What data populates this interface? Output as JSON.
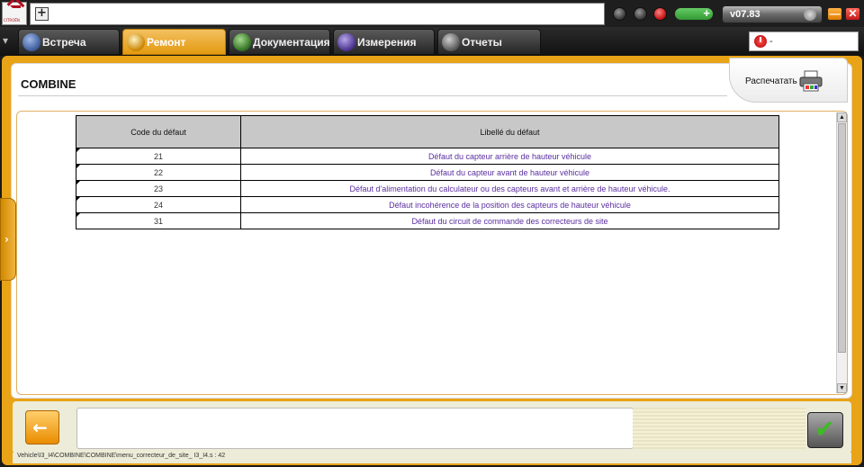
{
  "app": {
    "logo_text": "CITROËN",
    "version": "v07.83"
  },
  "tabs": [
    {
      "label": "Встреча",
      "icon": "reception-icon",
      "color": "#5a7fbf"
    },
    {
      "label": "Ремонт",
      "icon": "magnifier-icon",
      "color": "#e39a10"
    },
    {
      "label": "Документация",
      "icon": "document-icon",
      "color": "#4d8f3a"
    },
    {
      "label": "Измерения",
      "icon": "waveform-icon",
      "color": "#6a4fb0"
    },
    {
      "label": "Отчеты",
      "icon": "report-icon",
      "color": "#777777"
    }
  ],
  "search": {
    "value": "-"
  },
  "page": {
    "title": "COMBINE",
    "print_label": "Распечатать"
  },
  "table": {
    "headers": [
      "Code du défaut",
      "Libellé du défaut"
    ],
    "rows": [
      {
        "code": "21",
        "label": "Défaut du capteur arrière de hauteur véhicule"
      },
      {
        "code": "22",
        "label": "Défaut du capteur avant de hauteur véhicule"
      },
      {
        "code": "23",
        "label": "Défaut d'alimentation du calculateur ou des capteurs avant et arrière de hauteur véhicule."
      },
      {
        "code": "24",
        "label": "Défaut incohérence de la position des capteurs de hauteur véhicule"
      },
      {
        "code": "31",
        "label": "Défaut du circuit de commande des correcteurs de site"
      }
    ]
  },
  "status": {
    "path": "Vehicle\\I3_I4\\COMBINE\\COMBINE\\menu_correcteur_de_site_ I3_I4.s : 42"
  },
  "colors": {
    "accent": "#e9a316",
    "link": "#5a2ea0"
  }
}
